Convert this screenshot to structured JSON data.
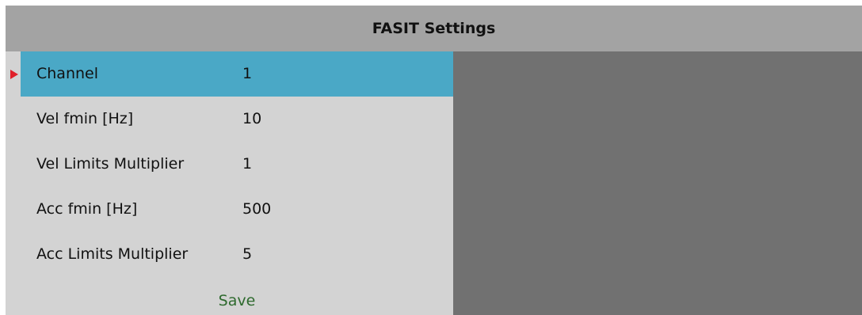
{
  "window": {
    "title": "FASIT Settings"
  },
  "settings": [
    {
      "label": "Channel",
      "value": "1"
    },
    {
      "label": "Vel fmin [Hz]",
      "value": "10"
    },
    {
      "label": "Vel Limits Multiplier",
      "value": "1"
    },
    {
      "label": "Acc fmin [Hz]",
      "value": "500"
    },
    {
      "label": "Acc Limits Multiplier",
      "value": "5"
    }
  ],
  "actions": {
    "save_label": "Save"
  },
  "colors": {
    "selected_row": "#4aa8c6",
    "title_bar": "#a3a3a3",
    "panel_bg": "#d3d3d3",
    "right_panel": "#717171",
    "marker": "#e0202a",
    "save_text": "#2e6a2e"
  }
}
